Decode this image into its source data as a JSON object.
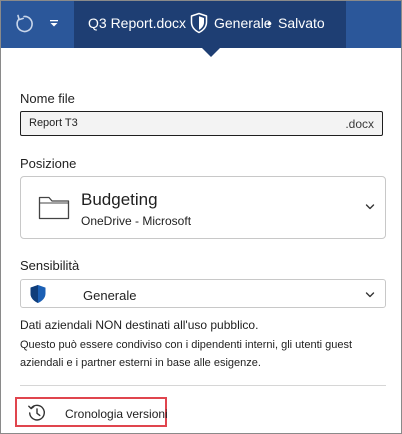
{
  "titlebar": {
    "doc_name": "Q3 Report.docx",
    "sensitivity_label": "Generale",
    "separator": "•",
    "status": "Salvato",
    "icons": [
      "undo-icon",
      "dropdown-caret-icon",
      "shield-icon"
    ]
  },
  "panel": {
    "filename": {
      "label": "Nome file",
      "value": "Report T3",
      "extension": ".docx"
    },
    "location": {
      "label": "Posizione",
      "folder": "Budgeting",
      "path": "OneDrive - Microsoft",
      "icon": "folder-icon"
    },
    "sensitivity": {
      "label": "Sensibilità",
      "value": "Generale",
      "icon": "shield-icon",
      "description": "Dati aziendali NON destinati all'uso pubblico.",
      "detail": "Questo può essere condiviso con i dipendenti interni, gli utenti guest aziendali e i partner esterni in base alle esigenze."
    },
    "history": {
      "label": "Cronologia versioni",
      "icon": "history-icon"
    }
  },
  "colors": {
    "titlebar_bg": "#2b579a",
    "title_area_bg": "#1e3e73",
    "shield_blue": "#1b5fb4",
    "highlight_border": "#e0454e"
  }
}
